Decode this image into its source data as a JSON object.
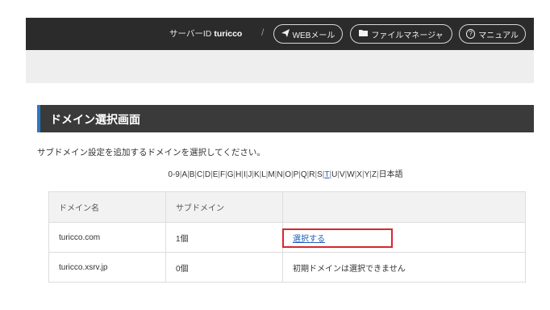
{
  "header": {
    "server_id_label": "サーバーID",
    "server_id_value": "turicco",
    "separator": "/",
    "webmail_label": "WEBメール",
    "filemanager_label": "ファイルマネージャ",
    "manual_label": "マニュアル",
    "manual_icon_char": "?"
  },
  "panel": {
    "title": "ドメイン選択画面",
    "description": "サブドメイン設定を追加するドメインを選択してください。"
  },
  "alphabet": {
    "items": [
      "0-9",
      "A",
      "B",
      "C",
      "D",
      "E",
      "F",
      "G",
      "H",
      "I",
      "J",
      "K",
      "L",
      "M",
      "N",
      "O",
      "P",
      "Q",
      "R",
      "S",
      "T",
      "U",
      "V",
      "W",
      "X",
      "Y",
      "Z",
      "日本語"
    ],
    "active": "T"
  },
  "table": {
    "headers": [
      "ドメイン名",
      "サブドメイン",
      ""
    ],
    "rows": [
      {
        "domain": "turicco.com",
        "count": "1個",
        "action": "選択する",
        "action_is_link": true
      },
      {
        "domain": "turicco.xsrv.jp",
        "count": "0個",
        "action": "初期ドメインは選択できません",
        "action_is_link": false
      }
    ]
  },
  "colors": {
    "topbar": "#2b2b2b",
    "accent": "#2a78c7",
    "link": "#1f5fb8",
    "highlight": "#d9262e"
  }
}
